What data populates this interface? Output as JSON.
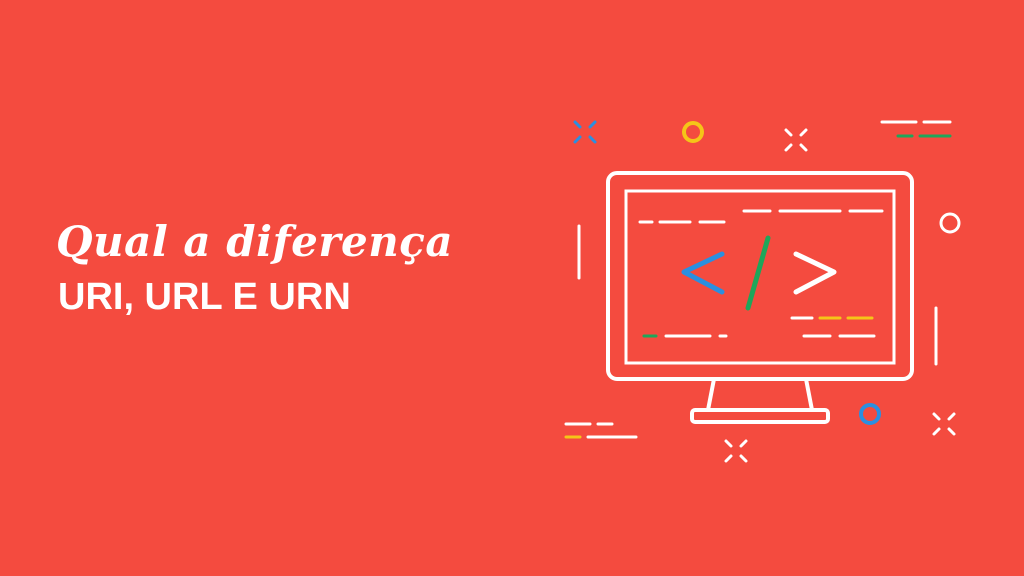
{
  "banner": {
    "title_script": "Qual a diferença",
    "subtitle": "URI, URL E URN"
  },
  "illustration": {
    "code_symbol": "</>",
    "icon": "computer-monitor-code-icon"
  },
  "colors": {
    "background": "#f44b3f",
    "line": "#ffffff",
    "blue": "#2b8fe0",
    "green": "#1fa65a",
    "yellow": "#f5c518"
  }
}
